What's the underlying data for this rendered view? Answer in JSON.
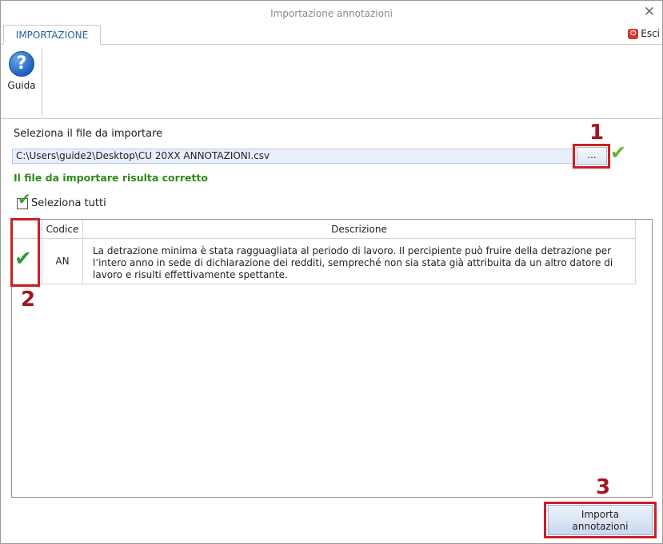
{
  "window": {
    "title": "Importazione annotazioni",
    "close_glyph": "✕"
  },
  "ribbon": {
    "tab_label": "IMPORTAZIONE",
    "exit_label": "Esci",
    "help_label": "Guida",
    "help_glyph": "?"
  },
  "file": {
    "label": "Seleziona il file da importare",
    "path": "C:\\Users\\guide2\\Desktop\\CU 20XX ANNOTAZIONI.csv",
    "browse_label": "...",
    "status": "Il file da importare risulta corretto",
    "ok_glyph": "✔"
  },
  "select_all": {
    "label": "Seleziona tutti",
    "checked": true,
    "glyph": "✔"
  },
  "table": {
    "columns": [
      "",
      "Codice",
      "Descrizione"
    ],
    "rows": [
      {
        "checked": true,
        "glyph": "✔",
        "code": "AN",
        "description": "La detrazione minima è stata ragguagliata al periodo di lavoro. Il percipiente può fruire della detrazione per l’intero anno in sede di dichiarazione dei redditi, sempreché non sia stata già attribuita da un altro datore di lavoro e risulti effettivamente spettante."
      }
    ]
  },
  "import_button": {
    "line1": "Importa",
    "line2": "annotazioni"
  },
  "callouts": [
    "1",
    "2",
    "3"
  ],
  "colors": {
    "callout": "#cc1f27",
    "status_ok": "#2e8b1a",
    "accent_tab": "#2e5f9e"
  },
  "icons": {
    "help": "help-circle-icon",
    "exit": "power-icon",
    "ok": "check-icon",
    "close": "close-icon"
  }
}
